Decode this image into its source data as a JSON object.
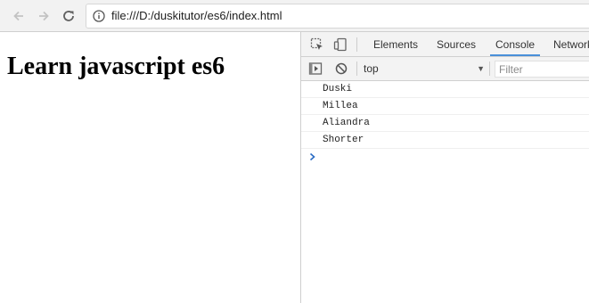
{
  "browser": {
    "url": "file:///D:/duskitutor/es6/index.html",
    "icons": {
      "back": "arrow-left-icon",
      "forward": "arrow-right-icon",
      "reload": "reload-icon",
      "info": "info-icon"
    }
  },
  "page": {
    "heading": "Learn javascript es6"
  },
  "devtools": {
    "tabs": [
      {
        "label": "Elements",
        "active": false
      },
      {
        "label": "Sources",
        "active": false
      },
      {
        "label": "Console",
        "active": true
      },
      {
        "label": "Network",
        "active": false
      }
    ],
    "toolbar": {
      "context": "top",
      "filter_placeholder": "Filter"
    },
    "console_logs": [
      "Duski",
      "Millea",
      "Aliandra",
      "Shorter"
    ],
    "colors": {
      "active_tab_underline": "#4a90d9",
      "prompt": "#2b6cc4"
    }
  }
}
